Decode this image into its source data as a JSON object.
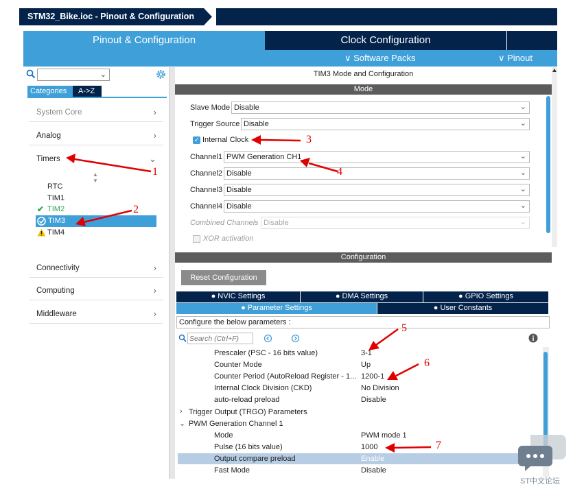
{
  "title": "STM32_Bike.ioc - Pinout & Configuration",
  "tabs": {
    "pinout": "Pinout & Configuration",
    "clock": "Clock Configuration"
  },
  "toolbar": {
    "software_packs": "∨ Software Packs",
    "pinout": "∨ Pinout"
  },
  "sidebar": {
    "categories_tab": "Categories",
    "az_tab": "A->Z",
    "system_core": "System Core",
    "analog": "Analog",
    "timers": "Timers",
    "timers_list": [
      "RTC",
      "TIM1",
      "TIM2",
      "TIM3",
      "TIM4"
    ],
    "connectivity": "Connectivity",
    "computing": "Computing",
    "middleware": "Middleware"
  },
  "mode": {
    "panel_title": "TIM3 Mode and Configuration",
    "header": "Mode",
    "slave_mode_label": "Slave Mode",
    "slave_mode_value": "Disable",
    "trigger_source_label": "Trigger Source",
    "trigger_source_value": "Disable",
    "internal_clock_label": "Internal Clock",
    "channel1_label": "Channel1",
    "channel1_value": "PWM Generation CH1",
    "channel2_label": "Channel2",
    "channel2_value": "Disable",
    "channel3_label": "Channel3",
    "channel3_value": "Disable",
    "channel4_label": "Channel4",
    "channel4_value": "Disable",
    "combined_label": "Combined Channels",
    "combined_value": "Disable",
    "xor_label": "XOR activation"
  },
  "config": {
    "header": "Configuration",
    "reset_button": "Reset Configuration",
    "tab_nvic": "NVIC Settings",
    "tab_dma": "DMA Settings",
    "tab_gpio": "GPIO Settings",
    "tab_params": "Parameter Settings",
    "tab_user": "User Constants",
    "hint": "Configure the below parameters :",
    "search_placeholder": "Search (Ctrl+F)",
    "params": [
      {
        "name": "Prescaler (PSC - 16 bits value)",
        "value": "3-1"
      },
      {
        "name": "Counter Mode",
        "value": "Up"
      },
      {
        "name": "Counter Period (AutoReload Register - 1...",
        "value": "1200-1"
      },
      {
        "name": "Internal Clock Division (CKD)",
        "value": "No Division"
      },
      {
        "name": "auto-reload preload",
        "value": "Disable"
      }
    ],
    "group_trgo": "Trigger Output (TRGO) Parameters",
    "group_pwm": "PWM Generation Channel 1",
    "pwm_params": [
      {
        "name": "Mode",
        "value": "PWM mode 1"
      },
      {
        "name": "Pulse (16 bits value)",
        "value": "1000"
      },
      {
        "name": "Output compare preload",
        "value": "Enable"
      },
      {
        "name": "Fast Mode",
        "value": "Disable"
      }
    ]
  },
  "annotations": [
    "1",
    "2",
    "3",
    "4",
    "5",
    "6",
    "7"
  ],
  "watermark": "ST中文论坛",
  "colors": {
    "navy": "#03234b",
    "blue": "#3fa0d9",
    "red": "#e00000",
    "green": "#2fa84f"
  }
}
